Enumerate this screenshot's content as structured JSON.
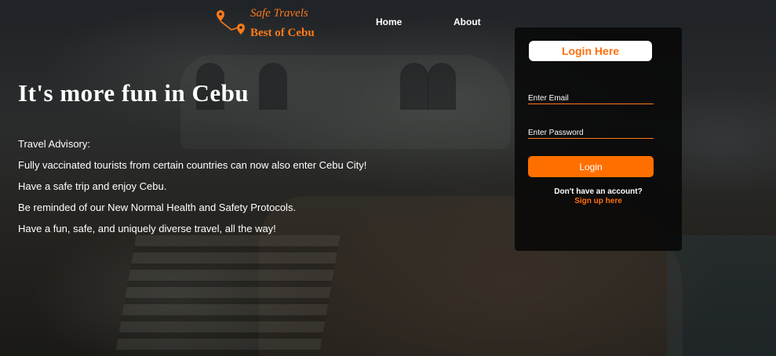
{
  "brand": {
    "top_text": "Safe Travels",
    "bottom_text": "Best of Cebu",
    "accent_color": "#ff7a1a"
  },
  "nav": {
    "home_label": "Home",
    "about_label": "About"
  },
  "hero": {
    "title": "It's more fun in Cebu",
    "advisory_lines": [
      "Travel Advisory:",
      "Fully vaccinated tourists from certain countries can now also enter Cebu City!",
      "Have a safe trip and enjoy Cebu.",
      "Be reminded of our New Normal Health and Safety Protocols.",
      "Have a fun, safe, and uniquely diverse travel, all the way!"
    ]
  },
  "login": {
    "heading": "Login Here",
    "email_placeholder": "Enter Email",
    "email_value": "",
    "password_placeholder": "Enter Password",
    "password_value": "",
    "button_label": "Login",
    "no_account_text": "Don't have an account?",
    "signup_label": "Sign up here",
    "button_color": "#ff6f00"
  },
  "icons": {
    "logo": "route-pin-icon"
  }
}
